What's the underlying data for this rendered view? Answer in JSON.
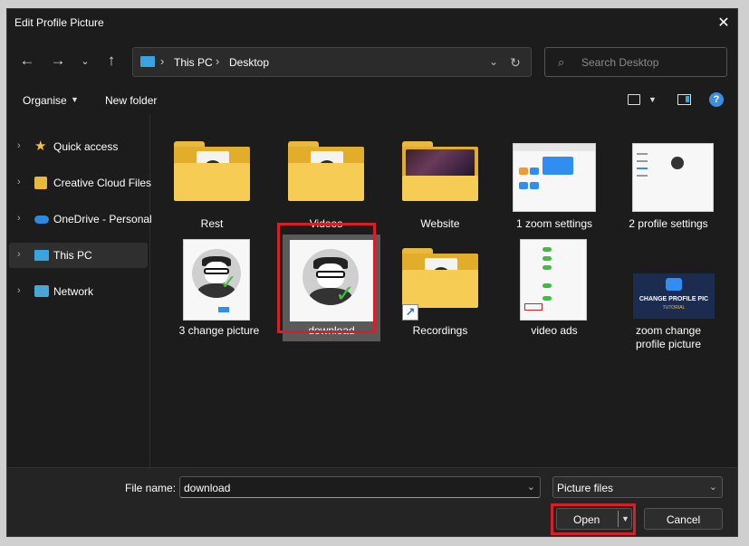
{
  "window": {
    "title": "Edit Profile Picture"
  },
  "nav": {
    "breadcrumb": [
      "This PC",
      "Desktop"
    ],
    "search_placeholder": "Search Desktop"
  },
  "toolbar": {
    "organise": "Organise",
    "new_folder": "New folder"
  },
  "sidebar": {
    "items": [
      {
        "label": "Quick access",
        "icon": "star-icon"
      },
      {
        "label": "Creative Cloud Files",
        "icon": "creative-cloud-icon"
      },
      {
        "label": "OneDrive - Personal",
        "icon": "onedrive-icon"
      },
      {
        "label": "This PC",
        "icon": "pc-icon",
        "selected": true
      },
      {
        "label": "Network",
        "icon": "network-icon"
      }
    ]
  },
  "files": {
    "items": [
      {
        "label": "Rest",
        "type": "folder"
      },
      {
        "label": "Videos",
        "type": "folder"
      },
      {
        "label": "Website",
        "type": "folder"
      },
      {
        "label": "1 zoom settings",
        "type": "image"
      },
      {
        "label": "2 profile settings",
        "type": "image"
      },
      {
        "label": "3 change picture",
        "type": "image"
      },
      {
        "label": "download",
        "type": "image",
        "selected": true
      },
      {
        "label": "Recordings",
        "type": "folder-shortcut"
      },
      {
        "label": "video ads",
        "type": "image"
      },
      {
        "label": "zoom change profile picture",
        "type": "image",
        "thumb_text": "CHANGE PROFILE PIC",
        "thumb_subtext": "TUTORIAL"
      }
    ]
  },
  "footer": {
    "file_name_label": "File name:",
    "file_name_value": "download",
    "file_type": "Picture files",
    "open_label": "Open",
    "cancel_label": "Cancel"
  },
  "colors": {
    "highlight": "#d61f27",
    "accent": "#3aa4e0",
    "folder": "#f6cc55"
  }
}
